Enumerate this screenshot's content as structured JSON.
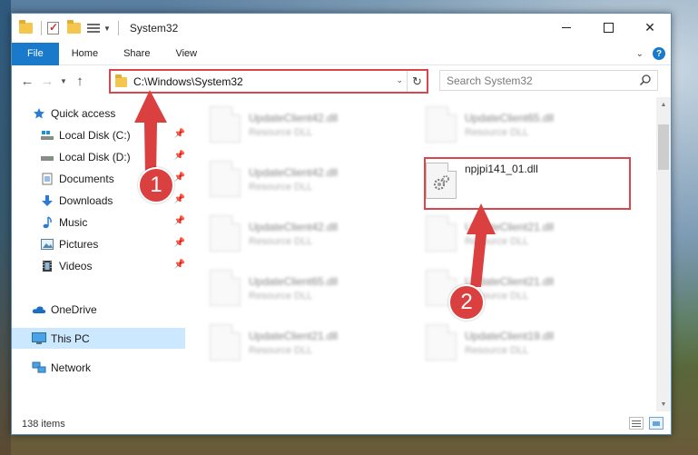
{
  "window": {
    "title": "System32",
    "controls": {
      "minimize": "",
      "maximize": "",
      "close": "✕"
    }
  },
  "ribbon": {
    "tabs": [
      "File",
      "Home",
      "Share",
      "View"
    ],
    "help": "?"
  },
  "nav": {
    "address": "C:\\Windows\\System32",
    "search_placeholder": "Search System32"
  },
  "sidebar": {
    "items": [
      {
        "label": "Quick access",
        "icon": "star-icon",
        "pinned": false
      },
      {
        "label": "Local Disk (C:)",
        "icon": "drive-icon",
        "pinned": true
      },
      {
        "label": "Local Disk (D:)",
        "icon": "drive-icon",
        "pinned": true
      },
      {
        "label": "Documents",
        "icon": "documents-icon",
        "pinned": true
      },
      {
        "label": "Downloads",
        "icon": "download-icon",
        "pinned": true
      },
      {
        "label": "Music",
        "icon": "music-icon",
        "pinned": true
      },
      {
        "label": "Pictures",
        "icon": "pictures-icon",
        "pinned": true
      },
      {
        "label": "Videos",
        "icon": "videos-icon",
        "pinned": true
      },
      {
        "label": "OneDrive",
        "icon": "cloud-icon",
        "pinned": false
      },
      {
        "label": "This PC",
        "icon": "computer-icon",
        "pinned": false,
        "selected": true
      },
      {
        "label": "Network",
        "icon": "network-icon",
        "pinned": false
      }
    ]
  },
  "files": {
    "left_column": [
      {
        "name": "UpdateClient42.dll",
        "type": "Resource DLL"
      },
      {
        "name": "UpdateClient42.dll",
        "type": "Resource DLL"
      },
      {
        "name": "UpdateClient42.dll",
        "type": "Resource DLL"
      },
      {
        "name": "UpdateClient65.dll",
        "type": "Resource DLL"
      },
      {
        "name": "UpdateClient21.dll",
        "type": "Resource DLL"
      }
    ],
    "right_column": [
      {
        "name": "UpdateClient65.dll",
        "type": "Resource DLL"
      },
      {
        "name": "npjpi141_01.dll",
        "type": ""
      },
      {
        "name": "UpdateClient21.dll",
        "type": "Resource DLL"
      },
      {
        "name": "UpdateClient21.dll",
        "type": "Resource DLL"
      },
      {
        "name": "UpdateClient19.dll",
        "type": "Resource DLL"
      }
    ]
  },
  "status": {
    "item_count": "138 items"
  },
  "annotations": {
    "step1": "1",
    "step2": "2",
    "color": "#d9403f"
  }
}
